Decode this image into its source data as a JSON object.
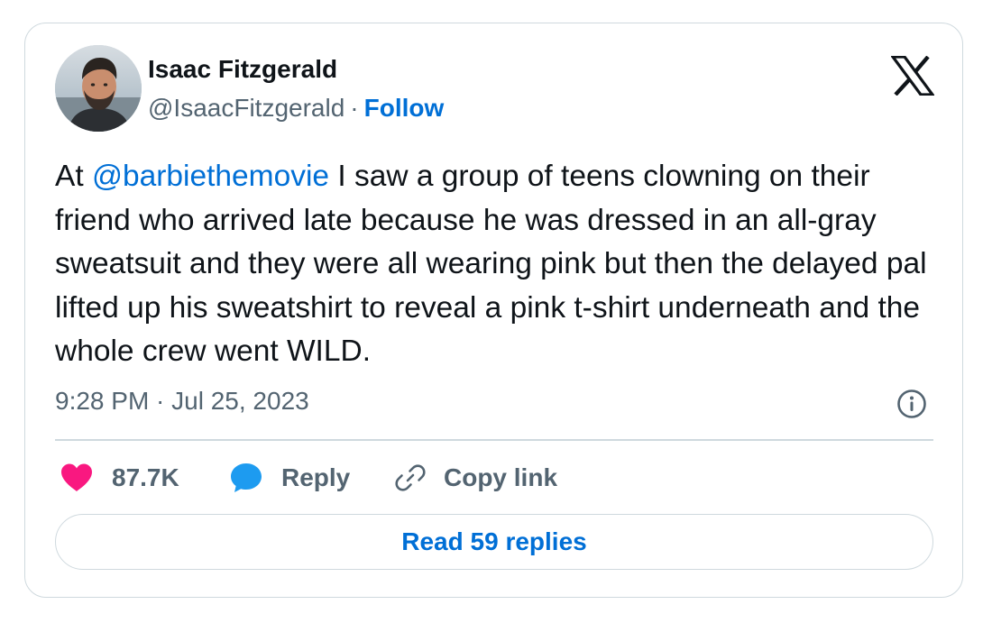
{
  "tweet": {
    "author": {
      "name": "Isaac Fitzgerald",
      "handle": "@IsaacFitzgerald",
      "separator": "·",
      "follow_label": "Follow"
    },
    "brand_icon": "x-logo-icon",
    "text": {
      "before_mention": "At ",
      "mention": "@barbiethemovie",
      "after_mention": " I saw a group of teens clowning on their friend who arrived late because he was dressed in an all-gray sweatsuit and they were all wearing pink but then the delayed pal lifted up his sweatshirt to reveal a pink t-shirt underneath and the whole crew went WILD."
    },
    "timestamp": "9:28 PM · Jul 25, 2023",
    "actions": {
      "like": {
        "icon": "heart-icon",
        "count": "87.7K"
      },
      "reply": {
        "icon": "speech-bubble-icon",
        "label": "Reply"
      },
      "copy_link": {
        "icon": "link-icon",
        "label": "Copy link"
      }
    },
    "info_icon": "info-icon",
    "read_replies_label": "Read 59 replies"
  },
  "colors": {
    "text_primary": "#0f1419",
    "text_secondary": "#536471",
    "link_blue": "#006fd6",
    "like_pink": "#f91880",
    "reply_blue": "#1d9bf0",
    "border": "#cfd9de"
  }
}
